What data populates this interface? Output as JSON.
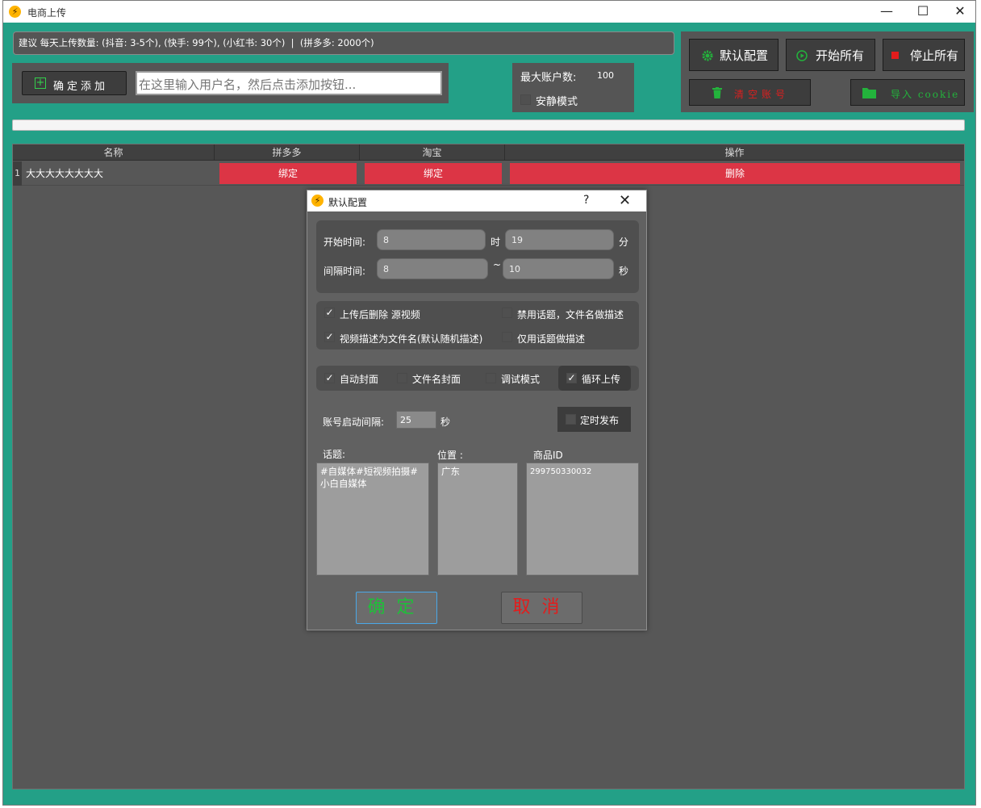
{
  "window": {
    "title": "电商上传",
    "minimize": "—",
    "maximize": "☐",
    "close": "✕"
  },
  "notice": {
    "text": "建议 每天上传数量: (抖音: 3-5个), (快手: 99个), (小红书: 30个)  |  (拼多多: 2000个)"
  },
  "add_panel": {
    "button_label": "确定添加",
    "input_placeholder": "在这里输入用户名，然后点击添加按钮..."
  },
  "account_panel": {
    "max_accounts_label": "最大账户数:",
    "max_accounts_value": "100",
    "quiet_mode_label": "安静模式",
    "quiet_mode_checked": false
  },
  "toolbar": {
    "default_config": "默认配置",
    "start_all": "开始所有",
    "stop_all": "停止所有",
    "clear_accounts": "清空账号",
    "import_cookie": "导入 cookie"
  },
  "table": {
    "columns": [
      "名称",
      "拼多多",
      "淘宝",
      "操作"
    ],
    "rows": [
      {
        "index": "1",
        "name": "大大大大大大大大",
        "pdd": "绑定",
        "taobao": "绑定",
        "action": "删除"
      }
    ]
  },
  "dialog": {
    "title": "默认配置",
    "help": "?",
    "close": "✕",
    "start_time": {
      "label": "开始时间:",
      "hour": "8",
      "hour_unit": "时",
      "minute": "19",
      "minute_unit": "分"
    },
    "interval": {
      "label": "间隔时间:",
      "from": "8",
      "sep": "~",
      "to": "10",
      "unit": "秒"
    },
    "options": {
      "delete_after_upload": "上传后删除 源视频",
      "desc_as_filename": "视频描述为文件名(默认随机描述)",
      "disable_topic": "禁用话题，文件名做描述",
      "topic_only": "仅用话题做描述",
      "auto_cover": "自动封面",
      "filename_cover": "文件名封面",
      "debug_mode": "调试模式",
      "loop_upload": "循环上传"
    },
    "account_interval": {
      "label": "账号启动间隔:",
      "value": "25",
      "unit": "秒"
    },
    "scheduled_publish": "定时发布",
    "topic_label": "话题:",
    "topic_value": "#自媒体#短视频拍摄#小白自媒体",
    "location_label": "位置 :",
    "location_value": "广东",
    "product_label": "商品ID",
    "product_value": "299750330032",
    "ok": "确定",
    "cancel": "取消"
  },
  "colors": {
    "background_teal": "#23a087",
    "panel_gray": "#555555",
    "danger_red": "#dc3545",
    "ok_green": "#1fbf3a",
    "cancel_red": "#e31c1c"
  }
}
